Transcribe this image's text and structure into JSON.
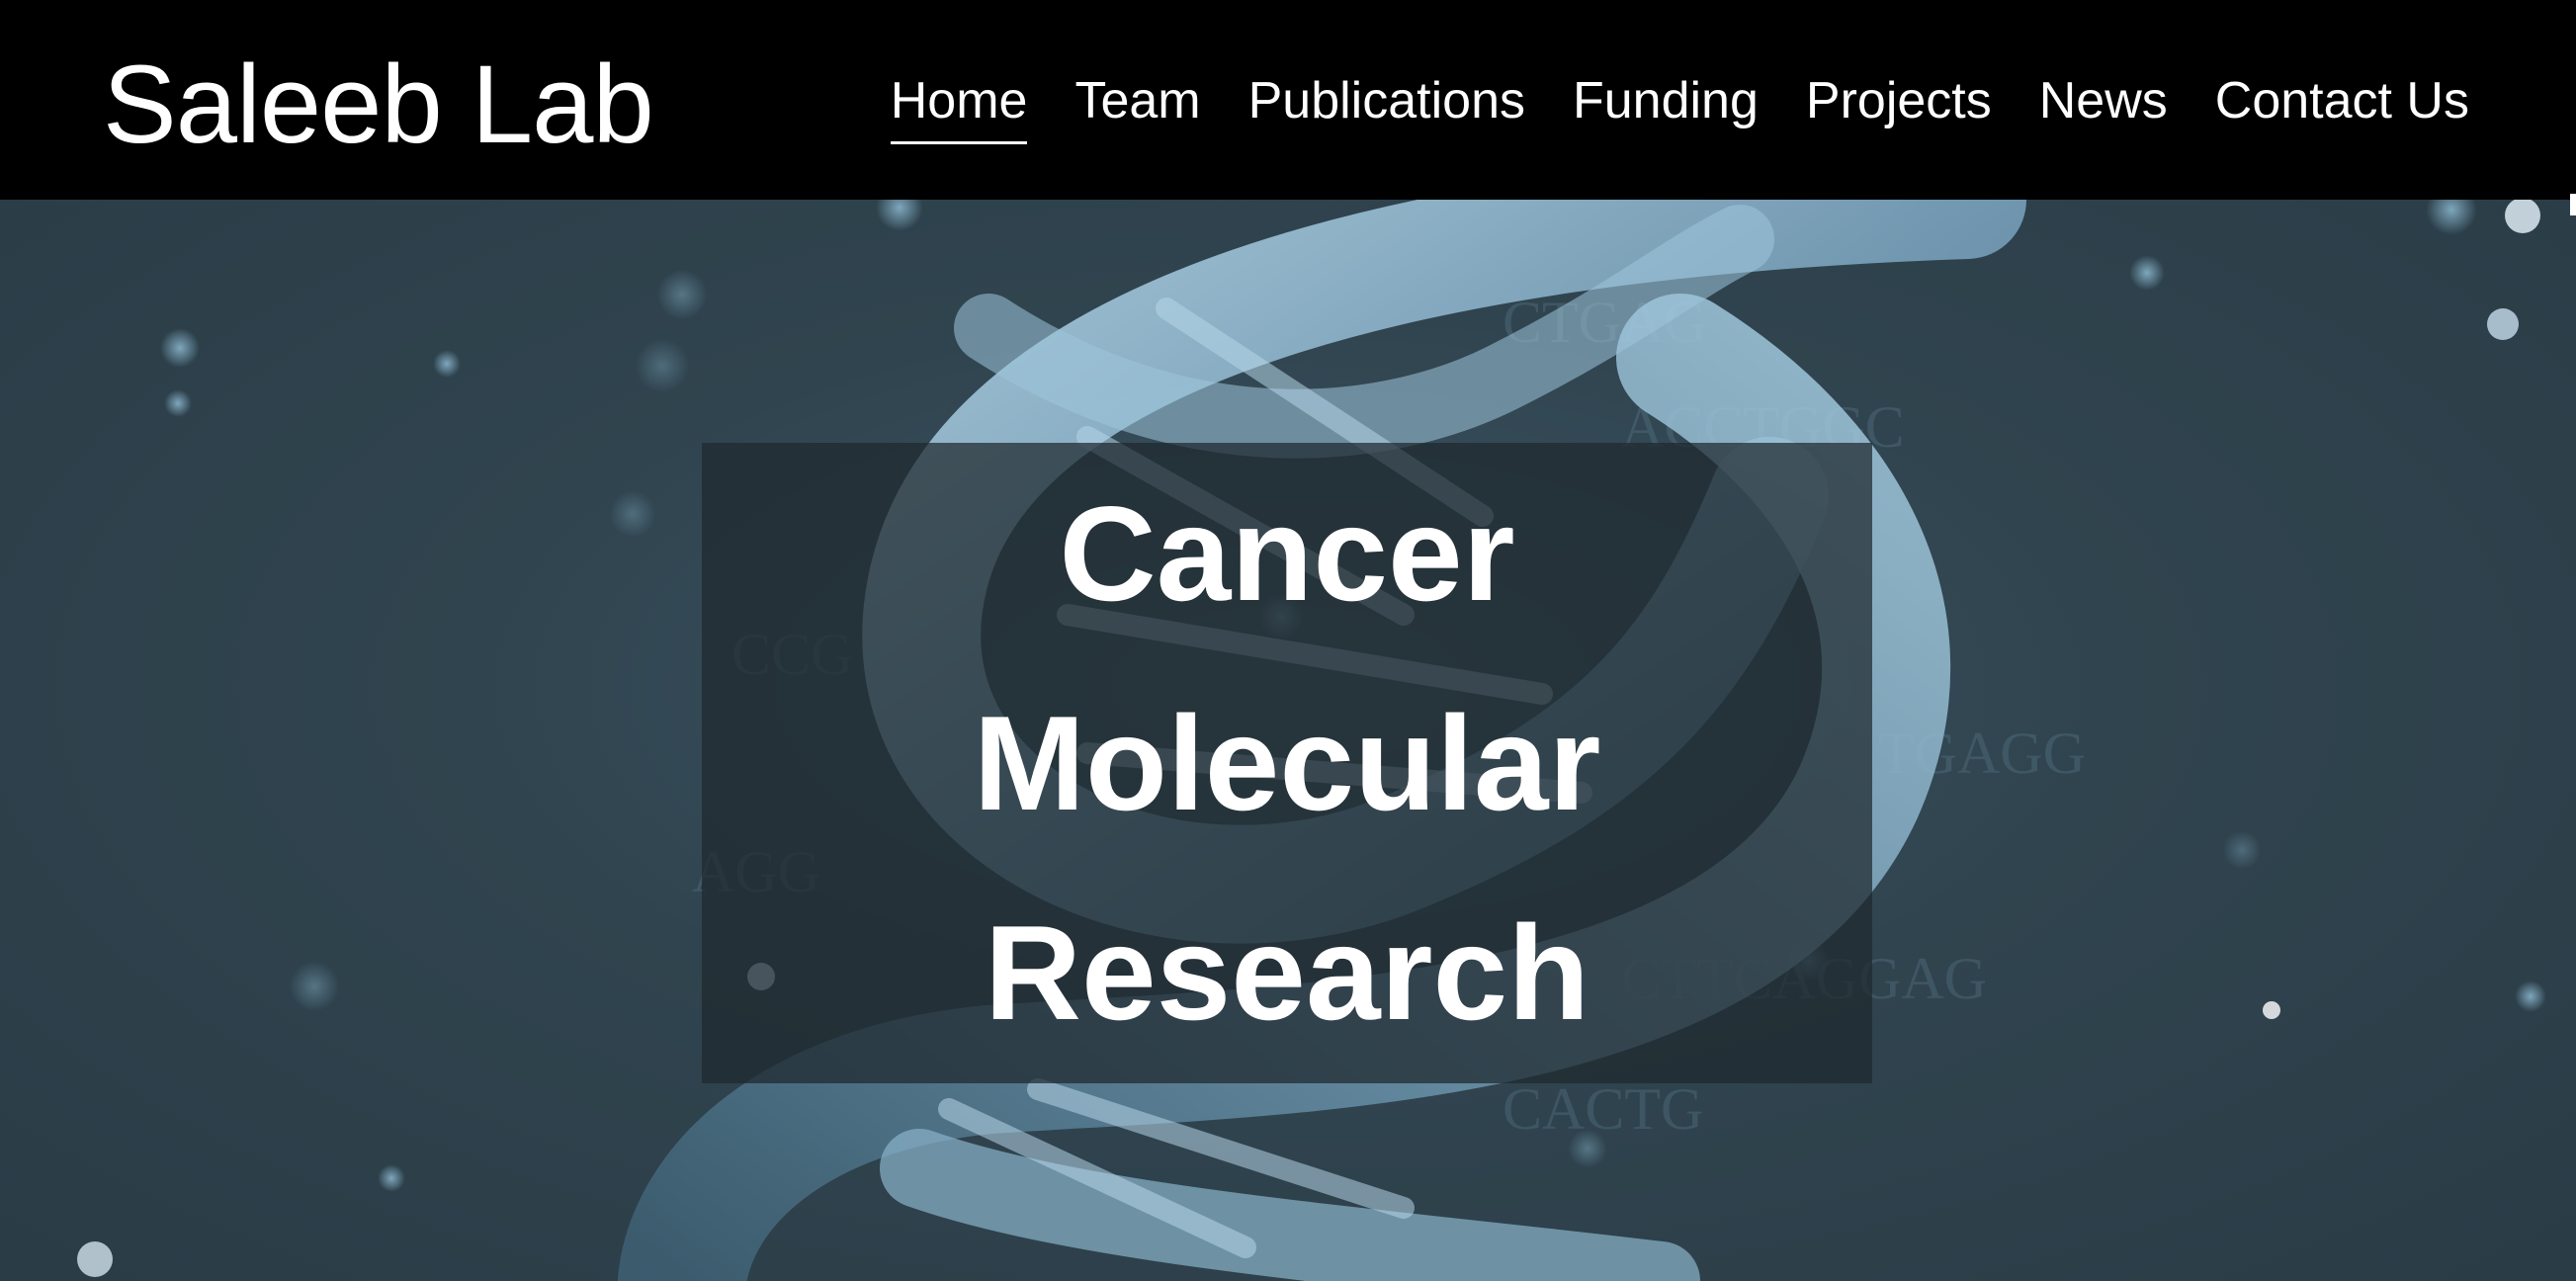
{
  "header": {
    "logo": "Saleeb Lab",
    "nav": [
      {
        "label": "Home",
        "active": true
      },
      {
        "label": "Team",
        "active": false
      },
      {
        "label": "Publications",
        "active": false
      },
      {
        "label": "Funding",
        "active": false
      },
      {
        "label": "Projects",
        "active": false
      },
      {
        "label": "News",
        "active": false
      },
      {
        "label": "Contact Us",
        "active": false
      }
    ]
  },
  "hero": {
    "lines": [
      "Cancer",
      "Molecular",
      "Research"
    ],
    "background_image": "dna-helix-image",
    "colors": {
      "background": "#2d3f48",
      "helix": "#8fb8d2",
      "overlay": "#1e282e"
    }
  }
}
